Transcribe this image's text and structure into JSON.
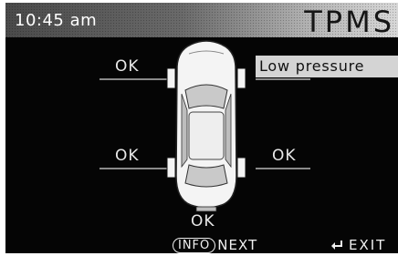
{
  "header": {
    "time": "10:45 am",
    "title": "TPMS"
  },
  "tires": {
    "front_left": {
      "status": "OK"
    },
    "front_right": {
      "status": "Low pressure"
    },
    "rear_left": {
      "status": "OK"
    },
    "rear_right": {
      "status": "OK"
    },
    "spare": {
      "status": "OK"
    }
  },
  "footer": {
    "info_label": "INFO",
    "next_label": "NEXT",
    "exit_label": "EXIT"
  },
  "colors": {
    "screen_bg": "#050505",
    "text": "#f2f2f2",
    "alert_bg": "#d4d4d4",
    "header_light": "#d8d8d8"
  },
  "icons": {
    "car": "car-top-view-icon",
    "enter": "enter-arrow-icon"
  }
}
